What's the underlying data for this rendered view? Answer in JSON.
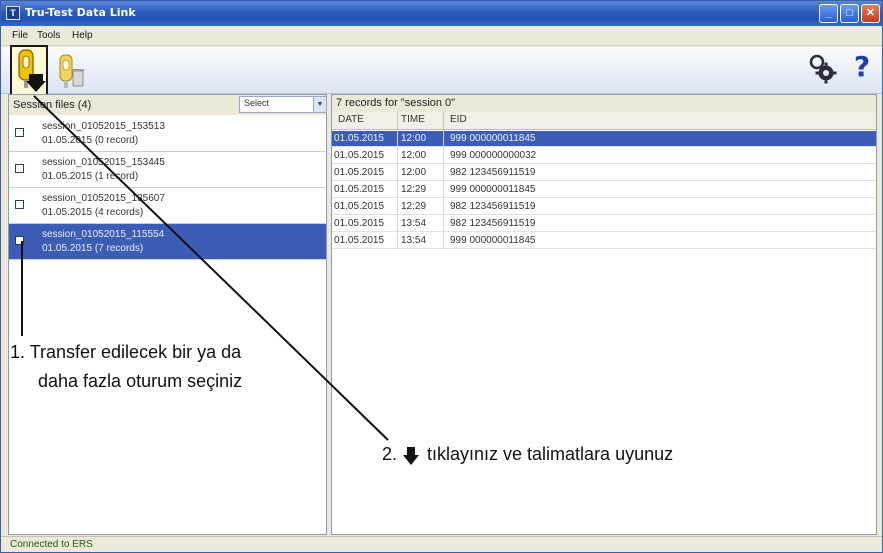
{
  "window": {
    "title": "Tru-Test Data Link",
    "app_icon_glyph": "T",
    "controls": {
      "minimize": "_",
      "maximize": "□",
      "close": "✕"
    }
  },
  "menu": {
    "file": "File",
    "tools": "Tools",
    "help": "Help"
  },
  "toolbar": {
    "transfer_icon": "transfer-to-computer-icon",
    "delete_icon": "delete-session-icon",
    "settings_icon": "settings-icon",
    "help_label": "?"
  },
  "left_panel": {
    "title": "Session files (4)",
    "select_value": "Select",
    "sessions": [
      {
        "name": "session_01052015_153513",
        "meta": "01.05.2015  (0 record)",
        "selected": false
      },
      {
        "name": "session_01052015_153445",
        "meta": "01.05.2015  (1 record)",
        "selected": false
      },
      {
        "name": "session_01052015_135607",
        "meta": "01.05.2015  (4 records)",
        "selected": false
      },
      {
        "name": "session_01052015_115554",
        "meta": "01.05.2015  (7 records)",
        "selected": true
      }
    ]
  },
  "right_panel": {
    "title": "7 records for \"session 0\"",
    "columns": {
      "date": "DATE",
      "time": "TIME",
      "eid": "EID"
    },
    "records": [
      {
        "date": "01.05.2015",
        "time": "12:00",
        "eid": "999 000000011845",
        "selected": true
      },
      {
        "date": "01.05.2015",
        "time": "12:00",
        "eid": "999 000000000032",
        "selected": false
      },
      {
        "date": "01.05.2015",
        "time": "12:00",
        "eid": "982 123456911519",
        "selected": false
      },
      {
        "date": "01.05.2015",
        "time": "12:29",
        "eid": "999 000000011845",
        "selected": false
      },
      {
        "date": "01.05.2015",
        "time": "12:29",
        "eid": "982 123456911519",
        "selected": false
      },
      {
        "date": "01.05.2015",
        "time": "13:54",
        "eid": "982 123456911519",
        "selected": false
      },
      {
        "date": "01.05.2015",
        "time": "13:54",
        "eid": "999 000000011845",
        "selected": false
      }
    ]
  },
  "status": {
    "text": "Connected to ERS"
  },
  "annotations": {
    "step1_line1": "1. Transfer edilecek bir ya da",
    "step1_line2": "daha fazla oturum seçiniz",
    "step2_number": "2.",
    "step2_text": "tıklayınız ve talimatlara uyunuz"
  },
  "colors": {
    "selection": "#3c5cb5",
    "titlebar": "#2c5bbd",
    "status_text": "#1a5c1a",
    "key_yellow": "#f2c200"
  }
}
